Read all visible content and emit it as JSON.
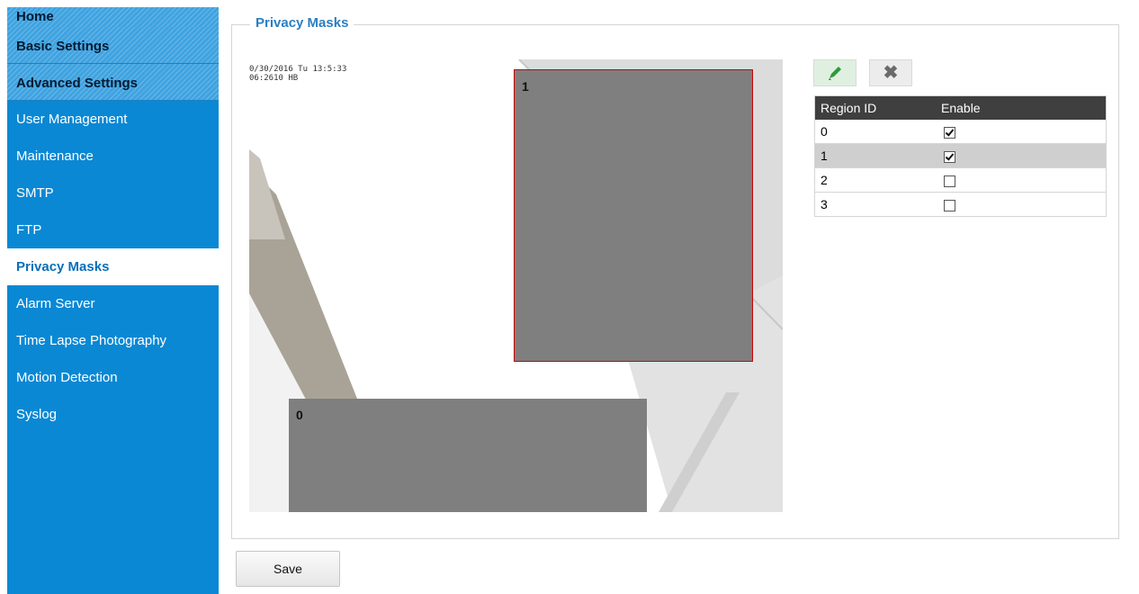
{
  "sidebar": {
    "headers": [
      "Home",
      "Basic Settings",
      "Advanced Settings"
    ],
    "items": [
      "User Management",
      "Maintenance",
      "SMTP",
      "FTP",
      "Privacy Masks",
      "Alarm Server",
      "Time Lapse Photography",
      "Motion Detection",
      "Syslog"
    ],
    "active": "Privacy Masks"
  },
  "panel": {
    "title": "Privacy Masks"
  },
  "video": {
    "osd_line1": "0/30/2016 Tu 13:5:33",
    "osd_line2": "06:2610 HB"
  },
  "masks": [
    {
      "id": "1",
      "selected": true
    },
    {
      "id": "0",
      "selected": false
    }
  ],
  "tools": {
    "draw": "pencil-icon",
    "clear": "close-icon"
  },
  "table": {
    "headers": [
      "Region ID",
      "Enable"
    ],
    "rows": [
      {
        "id": "0",
        "enabled": true
      },
      {
        "id": "1",
        "enabled": true
      },
      {
        "id": "2",
        "enabled": false
      },
      {
        "id": "3",
        "enabled": false
      }
    ],
    "selected_row": "1"
  },
  "save_label": "Save",
  "colors": {
    "sidebar": "#0a88d4",
    "accent": "#2a7fc1",
    "mask": "#7f7f7f",
    "mask_selected_border": "#d10000",
    "table_header": "#3f3f3f"
  }
}
